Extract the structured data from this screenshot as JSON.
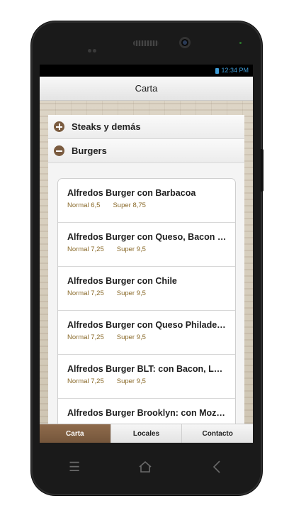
{
  "status": {
    "time": "12:34 PM"
  },
  "header": {
    "title": "Carta"
  },
  "accordion": [
    {
      "label": "Steaks y demás",
      "icon": "plus-circle-icon",
      "expanded": false
    },
    {
      "label": "Burgers",
      "icon": "minus-circle-icon",
      "expanded": true
    }
  ],
  "items": [
    {
      "name": "Alfredos Burger con Barbacoa",
      "normal": "Normal 6,5",
      "super": "Super 8,75"
    },
    {
      "name": "Alfredos Burger con Queso, Bacon …",
      "normal": "Normal 7,25",
      "super": "Super 9,5"
    },
    {
      "name": "Alfredos Burger con Chile",
      "normal": "Normal 7,25",
      "super": "Super 9,5"
    },
    {
      "name": "Alfredos Burger con Queso Philadel…",
      "normal": "Normal 7,25",
      "super": "Super 9,5"
    },
    {
      "name": "Alfredos Burger BLT: con Bacon, Le…",
      "normal": "Normal 7,25",
      "super": "Super 9,5"
    },
    {
      "name": "Alfredos Burger Brooklyn: con Moz…",
      "normal": "",
      "super": ""
    }
  ],
  "tabs": [
    {
      "label": "Carta",
      "active": true
    },
    {
      "label": "Locales",
      "active": false
    },
    {
      "label": "Contacto",
      "active": false
    }
  ],
  "colors": {
    "accent": "#7a5b3f",
    "price": "#8a6a2a",
    "status_text": "#3d9bd6"
  }
}
